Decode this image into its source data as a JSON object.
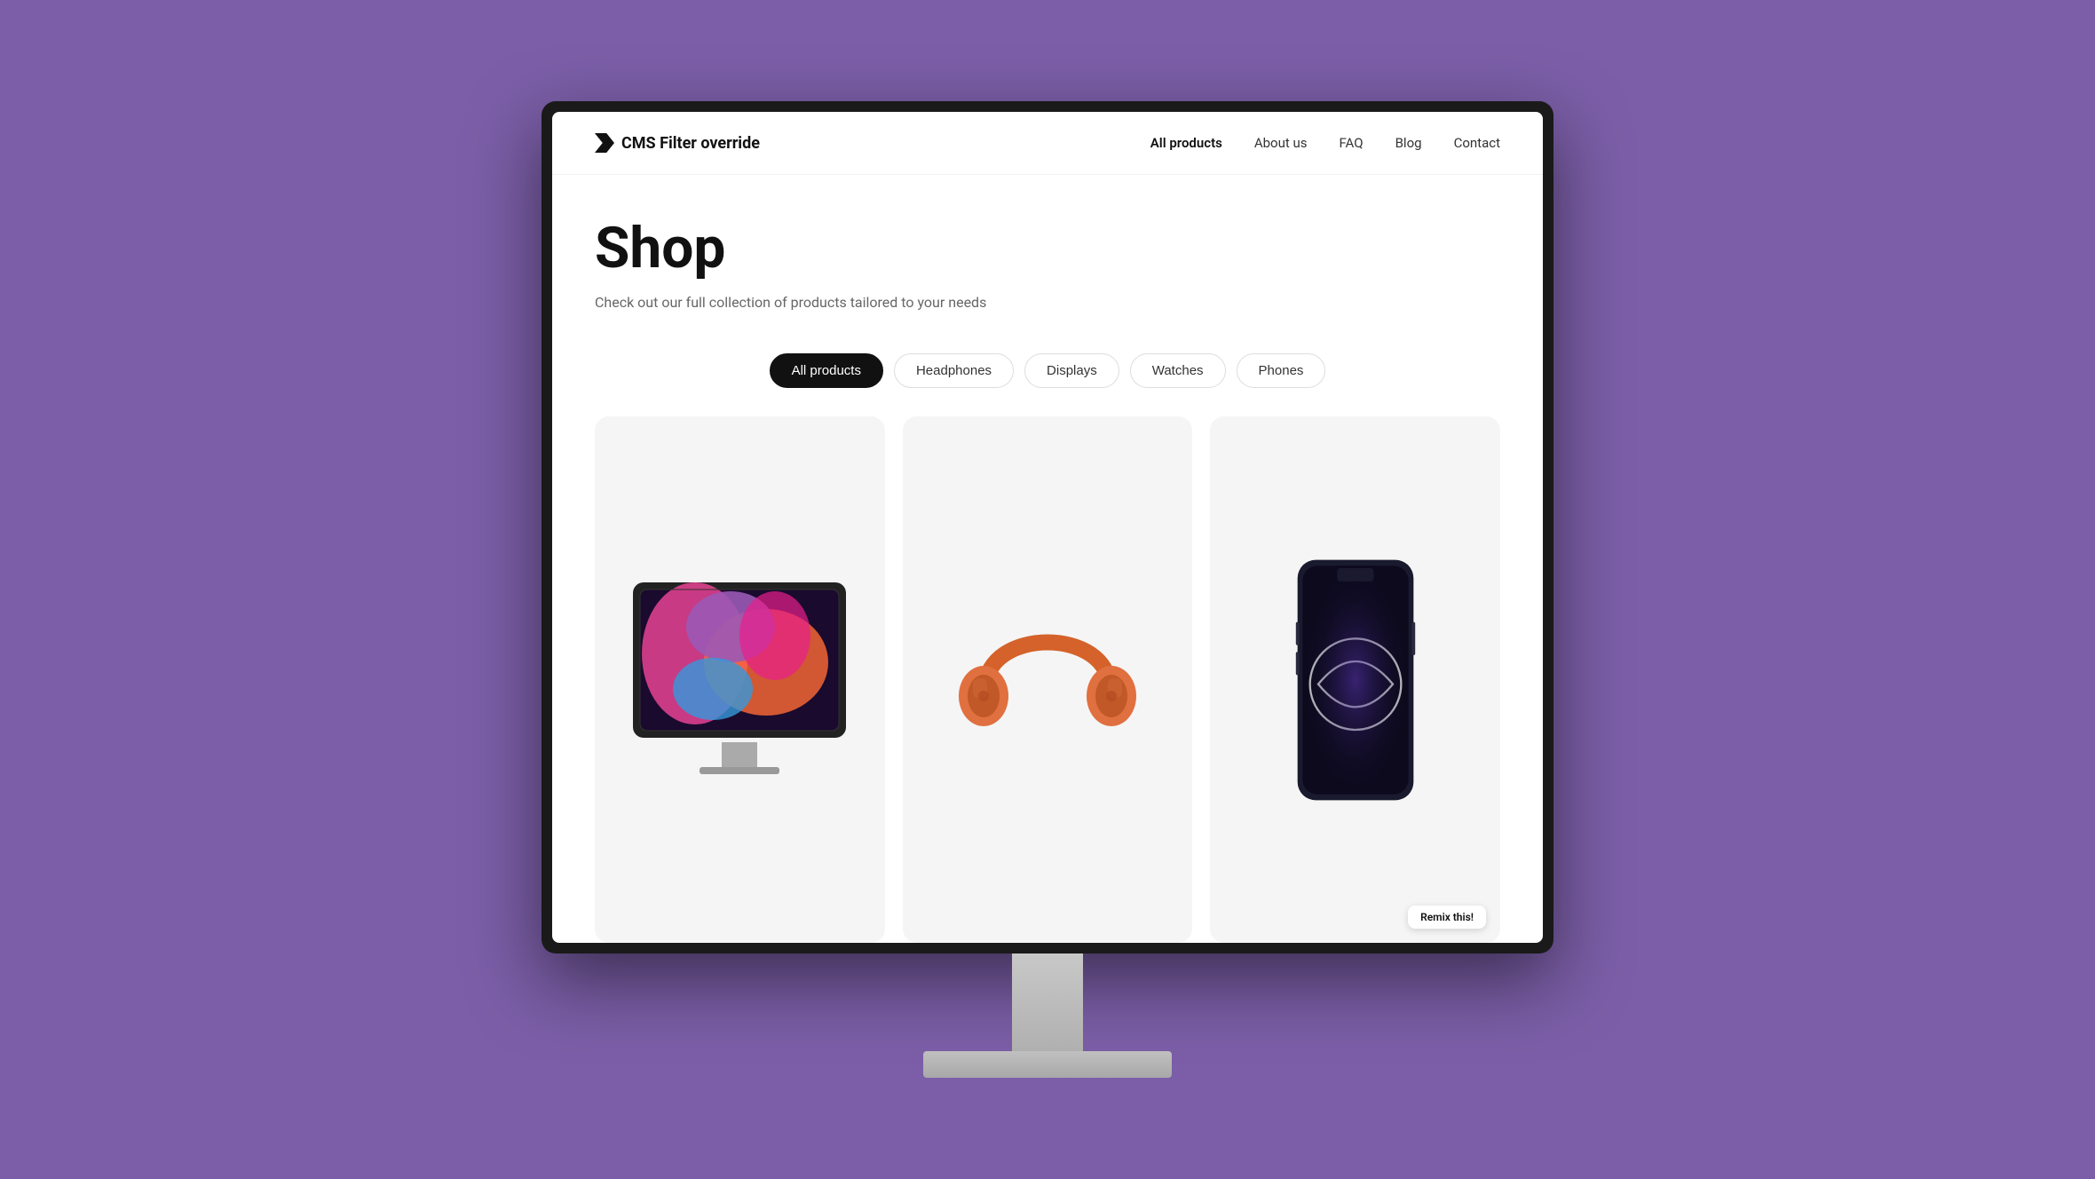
{
  "background_color": "#7b5ea7",
  "nav": {
    "logo_text": "CMS Filter override",
    "links": [
      {
        "label": "All products",
        "active": true
      },
      {
        "label": "About us",
        "active": false
      },
      {
        "label": "FAQ",
        "active": false
      },
      {
        "label": "Blog",
        "active": false
      },
      {
        "label": "Contact",
        "active": false
      }
    ]
  },
  "hero": {
    "title": "Shop",
    "subtitle": "Check out our full collection of products tailored to your needs"
  },
  "filter_tabs": [
    {
      "label": "All products",
      "active": true
    },
    {
      "label": "Headphones",
      "active": false
    },
    {
      "label": "Displays",
      "active": false
    },
    {
      "label": "Watches",
      "active": false
    },
    {
      "label": "Phones",
      "active": false
    }
  ],
  "products": [
    {
      "type": "display",
      "alt": "Display monitor with colorful wallpaper"
    },
    {
      "type": "headphones",
      "alt": "Orange over-ear headphones"
    },
    {
      "type": "phone",
      "alt": "Dark smartphone"
    }
  ],
  "remix_badge": {
    "label": "Remix this!"
  }
}
